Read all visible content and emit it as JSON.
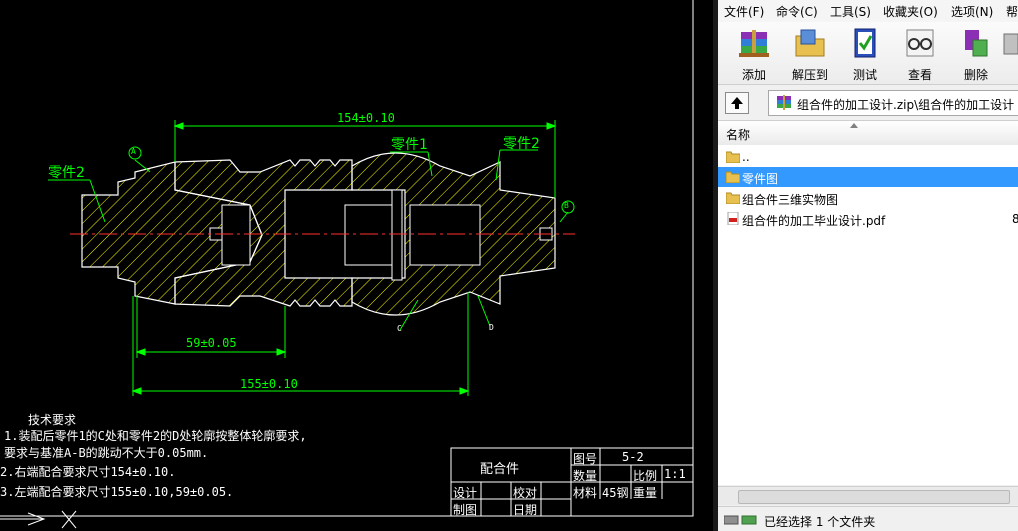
{
  "cad": {
    "dim_top": "154±0.10",
    "dim_mid": "59±0.05",
    "dim_bottom": "155±0.10",
    "label_part1": "零件1",
    "label_part2_left": "零件2",
    "label_part2_right": "零件2",
    "datum_a": "A",
    "datum_b": "B",
    "mark_c": "C",
    "mark_d": "D",
    "tech_title": "技术要求",
    "tech_lines": [
      "1.装配后零件1的C处和零件2的D处轮廓按整体轮廓要求,",
      "  要求与基准A-B的跳动不大于0.05mm.",
      " 2.右端配合要求尺寸154±0.10.",
      " 3.左端配合要求尺寸155±0.10,59±0.05."
    ],
    "title_block": {
      "name": "配合件",
      "drawing_no_label": "图号",
      "drawing_no": "5-2",
      "qty_label": "数量",
      "scale_label": "比例",
      "scale": "1:1",
      "material_label": "材料",
      "material": "45钢",
      "weight_label": "重量",
      "design_label": "设计",
      "check_label": "校对",
      "draw_label": "制图",
      "date_label": "日期"
    }
  },
  "rar": {
    "menu": [
      "文件(F)",
      "命令(C)",
      "工具(S)",
      "收藏夹(O)",
      "选项(N)",
      "帮"
    ],
    "toolbar": [
      {
        "label": "添加",
        "icon": "archive-add-icon"
      },
      {
        "label": "解压到",
        "icon": "extract-folder-icon"
      },
      {
        "label": "测试",
        "icon": "test-book-icon"
      },
      {
        "label": "查看",
        "icon": "view-glasses-icon"
      },
      {
        "label": "删除",
        "icon": "delete-recycle-icon"
      }
    ],
    "path": "组合件的加工设计.zip\\组合件的加工设计",
    "column_name": "名称",
    "files": [
      {
        "name": "..",
        "type": "folder",
        "size": ""
      },
      {
        "name": "零件图",
        "type": "folder",
        "size": "",
        "selected": true
      },
      {
        "name": "组合件三维实物图",
        "type": "folder",
        "size": ""
      },
      {
        "name": "组合件的加工毕业设计.pdf",
        "type": "pdf",
        "size": "8"
      }
    ],
    "status": "已经选择 1 个文件夹",
    "colors": {
      "selection": "#3399ff",
      "cad_green": "#00ff00",
      "cad_yellow": "#ffff00"
    }
  }
}
